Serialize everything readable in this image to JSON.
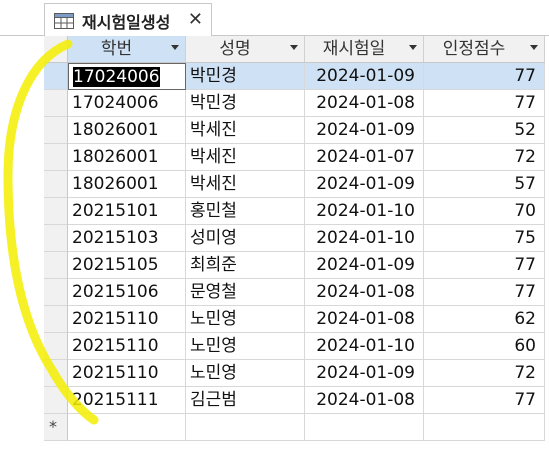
{
  "tab": {
    "title": "재시험일생성",
    "close": "✕"
  },
  "columns": [
    {
      "key": "hakbeon",
      "label": "학번"
    },
    {
      "key": "name",
      "label": "성명"
    },
    {
      "key": "date",
      "label": "재시험일"
    },
    {
      "key": "score",
      "label": "인정점수"
    }
  ],
  "rows": [
    {
      "hakbeon": "17024006",
      "name": "박민경",
      "date": "2024-01-09",
      "score": "77"
    },
    {
      "hakbeon": "17024006",
      "name": "박민경",
      "date": "2024-01-08",
      "score": "77"
    },
    {
      "hakbeon": "18026001",
      "name": "박세진",
      "date": "2024-01-09",
      "score": "52"
    },
    {
      "hakbeon": "18026001",
      "name": "박세진",
      "date": "2024-01-07",
      "score": "72"
    },
    {
      "hakbeon": "18026001",
      "name": "박세진",
      "date": "2024-01-09",
      "score": "57"
    },
    {
      "hakbeon": "20215101",
      "name": "홍민철",
      "date": "2024-01-10",
      "score": "70"
    },
    {
      "hakbeon": "20215103",
      "name": "성미영",
      "date": "2024-01-10",
      "score": "75"
    },
    {
      "hakbeon": "20215105",
      "name": "최희준",
      "date": "2024-01-09",
      "score": "77"
    },
    {
      "hakbeon": "20215106",
      "name": "문영철",
      "date": "2024-01-08",
      "score": "77"
    },
    {
      "hakbeon": "20215110",
      "name": "노민영",
      "date": "2024-01-08",
      "score": "62"
    },
    {
      "hakbeon": "20215110",
      "name": "노민영",
      "date": "2024-01-10",
      "score": "60"
    },
    {
      "hakbeon": "20215110",
      "name": "노민영",
      "date": "2024-01-09",
      "score": "72"
    },
    {
      "hakbeon": "20215111",
      "name": "김근범",
      "date": "2024-01-08",
      "score": "77"
    }
  ],
  "new_record_marker": "*",
  "annotation_color": "#f5ee00"
}
